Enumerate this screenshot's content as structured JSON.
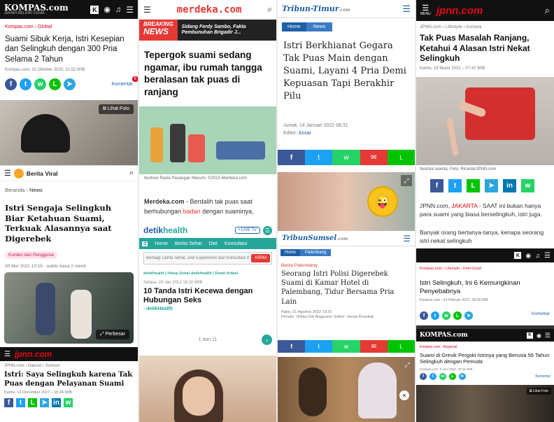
{
  "kompas1": {
    "logo": "KOMPAS.com",
    "tagline": "JERNIH MELIHAT DUNIA",
    "crumb1": "Kompas.com",
    "crumb2": "Global",
    "title": "Suami Sibuk Kerja, Istri Kesepian dan Selingkuh dengan 300 Pria Selama 2 Tahun",
    "meta": "Kompas.com, 31 Oktober 2020, 21:02 WIB",
    "komentar": "Komentar",
    "komentar_count": "6",
    "lihat_foto": "Lihat Foto"
  },
  "beritaviral": {
    "site": "Berita Viral",
    "crumb_home": "Beranda",
    "crumb_sec": "News",
    "title": "Istri Sengaja Selingkuh Biar Ketahuan Suami, Terkuak Alasannya saat Digerebek",
    "badge": "Konten dari Pengguna",
    "meta": "30 Mei 2021 10:15",
    "read": "waktu baca 2 menit",
    "perbesar": "Perbesar"
  },
  "jpnn_bl": {
    "logo": "jpnn.com",
    "crumb": [
      "JPNN.com",
      "Daerah",
      "Sumsel"
    ],
    "title": "Istri: Saya Selingkuh karena Tak Puas dengan Pelayanan Suami",
    "meta": "Kamis, 14 December 2017 – 16:24 WIB"
  },
  "merdeka": {
    "logo": "merdeka.com",
    "breaking1": "BREAKING",
    "breaking2": "NEWS",
    "ticker": "Sidang Ferdy Sambo, Fakta Pembunuhan Brigadir J...",
    "title": "Tepergok suami sedang ngamar, ibu rumah tangga beralasan tak puas di ranjang",
    "caption": "Ilustrasi Razia Pasangan Mesum. ©2015 Merdeka.com",
    "lead_src": "Merdeka.com",
    "lead_a": " - Berdalih tak puas saat berhubungan ",
    "lead_red": "badan",
    "lead_b": " dengan suaminya,"
  },
  "detik": {
    "logo_a": "detik",
    "logo_b": "health",
    "live": "• LIVE TV",
    "nav": [
      "Home",
      "Berita Sehat",
      "Diet",
      "Konsultasi"
    ],
    "search_placeholder": "Berbagi Cerita Sehat, Diet Experience dan Konsultasi Kesehatan",
    "kirim": "KIRIM",
    "crumb": "detikHealth  |  Hidup Sehat detikHealth  |  Detail Artikel",
    "date": "Selasa, 24 Jan 2012 18:10 WIB",
    "title": "10 Tanda Istri Kecewa dengan Hubungan Seks",
    "source": "- detikHealth",
    "pager": "1 dari 11"
  },
  "tribuntimur": {
    "logo_a": "Tribun",
    "logo_b": "-Timur",
    "logo_c": ".com",
    "crumb": [
      "Home",
      "News"
    ],
    "title": "Istri Berkhianat Gegara Tak Puas Main dengan Suami, Layani 4 Pria Demi Kepuasan Tapi Berakhir Pilu",
    "meta": "Jumat, 14 Januari 2022 08:31",
    "editor_label": "Editor:",
    "editor": "Ansar"
  },
  "tribunsumsel": {
    "logo_a": "Tribun",
    "logo_b": "Sumsel",
    "logo_c": ".com",
    "crumb": [
      "Home",
      "Palembang"
    ],
    "kicker": "Berita Palembang",
    "title": "Seorang Istri Polisi Digerebek Suami di Kamar Hotel di Palembang, Tidur Bersama Pria Lain",
    "meta": "Rabu, 31 Agustus 2022 19:31",
    "penulis": "Penulis: Shinta Dwi Anggraini",
    "editor": "Editor: Vanda Rosetiati"
  },
  "jpnn_tr": {
    "logo": "jpnn.com",
    "menu": "MENU",
    "crumb": [
      "JPNN.com",
      "Lifestyle",
      "Asmara"
    ],
    "title": "Tak Puas Masalah Ranjang, Ketahui 4 Alasan Istri Nekat Selingkuh",
    "meta": "Kamis, 18 Maret 2021 – 07:42 WIB",
    "caption": "Ilustrasi wanita. Foto: Ricardo/JPNN.com",
    "lead_src": "JPNN.com,",
    "lead_city": "JAKARTA",
    "lead_a": " - SAAT ini bukan hanya para suami yang biasa berselingkuh, istri juga.",
    "lead_b": "Banyak orang bertanya-tanya, kenapa seorang istri nekat selingkuh"
  },
  "kompas2": {
    "crumb": [
      "Kompas.com",
      "Lifestyle",
      "Feel Good"
    ],
    "title": "Istri Selingkuh, Ini 6 Kemungkinan Penyebabnya",
    "meta": "Kompas.com - 14 Februari 2021, 18:38 WIB",
    "komentar": "Komentar"
  },
  "kompas3": {
    "logo": "KOMPAS.com",
    "crumb": [
      "Kompas.com",
      "Regional"
    ],
    "title": "Suami di Gresik Pergoki Istrinya yang Berusia 56 Tahun Selingkuh dengan Pemuda",
    "meta": "Kompas.com, 5 Juni 2022, 20:16 WIB",
    "komentar": "Komentar",
    "lihat_foto": "Lihat Foto"
  },
  "colors": {
    "kompas_red": "#e3001b",
    "jpnn_red": "#e30613",
    "tribun_blue": "#1e5fa8",
    "detik_green": "#26a69a",
    "share_fb": "#3b5998",
    "share_tw": "#1da1f2",
    "share_wa": "#25d366",
    "share_line": "#00c300",
    "share_tg": "#2ca5e0"
  }
}
